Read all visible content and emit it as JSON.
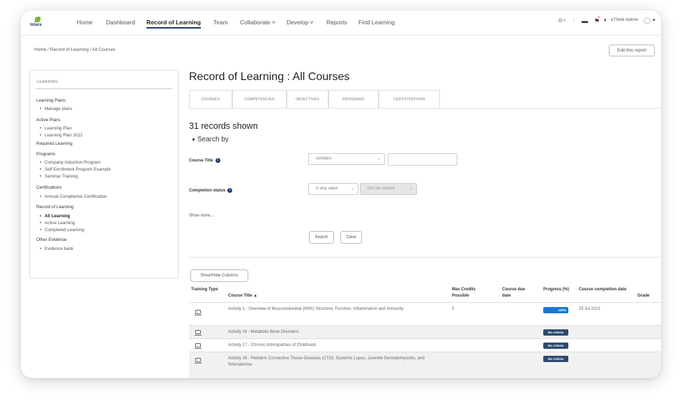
{
  "logo": {
    "text": "totara"
  },
  "nav": {
    "items": [
      {
        "label": "Home"
      },
      {
        "label": "Dashboard"
      },
      {
        "label": "Record of Learning"
      },
      {
        "label": "Team"
      },
      {
        "label": "Collaborate ˅"
      },
      {
        "label": "Develop ˅"
      },
      {
        "label": "Reports"
      },
      {
        "label": "Find Learning"
      }
    ],
    "right": {
      "gear": "⚙˅",
      "user": "eThink Admin"
    }
  },
  "breadcrumb": "Home / Record of Learning / All Courses",
  "edit_report": "Edit this report",
  "sidebar": {
    "heading": "LEARNING",
    "items": [
      {
        "label": "Learning Plans"
      },
      {
        "label": "Manage plans"
      },
      {
        "label": "Active Plans"
      },
      {
        "label": "Learning Plan"
      },
      {
        "label": "Learning Plan 2021"
      },
      {
        "label": "Required Learning"
      },
      {
        "label": "Programs"
      },
      {
        "label": "Company Induction Program"
      },
      {
        "label": "Self Enrollment Program Example"
      },
      {
        "label": "Seminar Training"
      },
      {
        "label": "Certifications"
      },
      {
        "label": "Annual Compliance Certification"
      },
      {
        "label": "Record of Learning"
      },
      {
        "label": "All Learning"
      },
      {
        "label": "Active Learning"
      },
      {
        "label": "Completed Learning"
      },
      {
        "label": "Other Evidence"
      },
      {
        "label": "Evidence bank"
      }
    ]
  },
  "page_title": "Record of Learning : All Courses",
  "tabs": [
    {
      "label": "COURSES"
    },
    {
      "label": "COMPETENCIES"
    },
    {
      "label": "OBJECTIVES"
    },
    {
      "label": "PROGRAMS"
    },
    {
      "label": "CERTIFICATIONS"
    }
  ],
  "records_shown": "31 records shown",
  "search_by": "Search by",
  "filters": {
    "course_title": {
      "label": "Course Title",
      "operator": "contains",
      "value": ""
    },
    "completion_status": {
      "label": "Completion status",
      "operator": "is any value",
      "value": "Not yet started"
    }
  },
  "show_more": "Show more...",
  "buttons": {
    "search": "Search",
    "clear": "Clear",
    "show_hide": "Show/Hide Columns"
  },
  "table": {
    "headers": {
      "type": "Training Type",
      "title": "Course Title ▲",
      "credits": "Max Credits Possible",
      "due": "Course due date",
      "progress": "Progress (%)",
      "completion": "Course completion date",
      "grade": "Grade"
    },
    "rows": [
      {
        "title": "Activity 1 - Overview of Musculoskeletal (MSK) Structure, Function, Inflammation and Immunity",
        "credits": "3",
        "due": "",
        "progress": "100%",
        "completion": "25 Jul 2021"
      },
      {
        "title": "Activity 16 - Metabolic Bone Disorders",
        "credits": "",
        "due": "",
        "progress": "No criteria",
        "completion": ""
      },
      {
        "title": "Activity 17 - Chronic Arthropathies of Childhood",
        "credits": "",
        "due": "",
        "progress": "No criteria",
        "completion": ""
      },
      {
        "title": "Activity 18 - Pediatric Connective Tissue Diseases (CTD): Systemic Lupus, Juvenile Dermatomyositis, and Scleroderma",
        "credits": "",
        "due": "",
        "progress": "No criteria",
        "completion": ""
      }
    ]
  },
  "colors": {
    "brand_navy": "#1c3d6b",
    "progress_blue": "#1976d2",
    "no_criteria": "#2c4a6e",
    "logo_green": "#7cb342"
  }
}
